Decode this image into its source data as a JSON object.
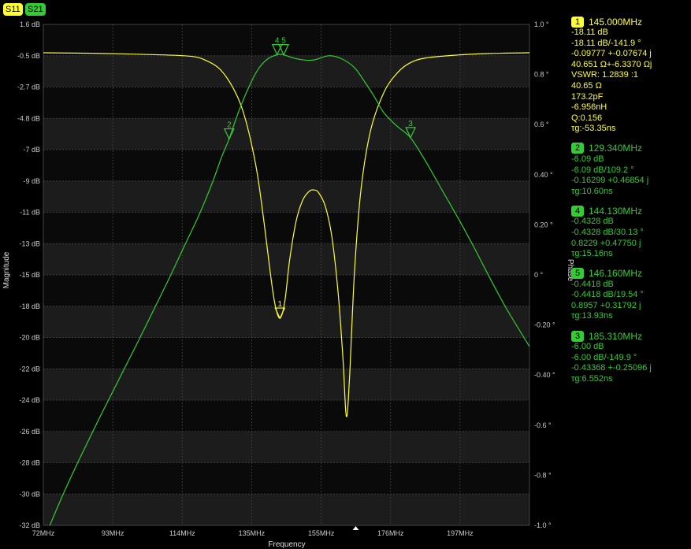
{
  "traces": {
    "s11": {
      "label": "S11",
      "color": "#ffff33"
    },
    "s21": {
      "label": "S21",
      "color": "#33cc33"
    }
  },
  "markers": [
    {
      "id": "1",
      "color": "#ffff33",
      "freq": "145.000MHz",
      "lines": [
        "-18.11 dB",
        "-18.11 dB/-141.9 °",
        "-0.09777 +-0.07674 j",
        "40.651 Ω+-6.3370 Ωj",
        "VSWR: 1.2839 :1",
        "40.65 Ω",
        "173.2pF",
        "-6.956nH",
        "Q:0.156",
        "τg:-53.35ns"
      ]
    },
    {
      "id": "2",
      "color": "#33cc33",
      "freq": "129.340MHz",
      "lines": [
        "-6.09 dB",
        "-6.09 dB/109.2 °",
        "-0.16299 +0.46854 j",
        "τg:10.60ns"
      ]
    },
    {
      "id": "4",
      "color": "#33cc33",
      "freq": "144.130MHz",
      "lines": [
        "-0.4328 dB",
        "-0.4328 dB/30.13 °",
        "0.8229 +0.47750 j",
        "τg:15.16ns"
      ]
    },
    {
      "id": "5",
      "color": "#33cc33",
      "freq": "146.160MHz",
      "lines": [
        "-0.4418 dB",
        "-0.4418 dB/19.54 °",
        "0.8957 +0.31792 j",
        "τg:13.93ns"
      ]
    },
    {
      "id": "3",
      "color": "#33cc33",
      "freq": "185.310MHz",
      "lines": [
        "-6.00 dB",
        "-6.00 dB/-149.9 °",
        "-0.43368 +-0.25096 j",
        "τg:6.552ns"
      ]
    }
  ],
  "chart_data": {
    "type": "line",
    "xlabel": "Frequency",
    "ylabel": "Magnitude",
    "y2label": "Phase",
    "xlim": [
      72,
      222
    ],
    "ylim": [
      -32,
      1.6
    ],
    "y2lim": [
      -1.0,
      1.0
    ],
    "grid": true,
    "x_ticks": [
      "72MHz",
      "93MHz",
      "114MHz",
      "135MHz",
      "155MHz",
      "176MHz",
      "197MHz"
    ],
    "y_ticks": [
      "1.6 dB",
      "-0.5 dB",
      "-2.7 dB",
      "-4.8 dB",
      "-7 dB",
      "-9 dB",
      "-11 dB",
      "-13 dB",
      "-15 dB",
      "-18 dB",
      "-20 dB",
      "-22 dB",
      "-24 dB",
      "-26 dB",
      "-28 dB",
      "-30 dB",
      "-32 dB"
    ],
    "y2_ticks": [
      "1.0 °",
      "0.8 °",
      "0.6 °",
      "0.40 °",
      "0.20 °",
      "0 °",
      "-0.20 °",
      "-0.40 °",
      "-0.6 °",
      "-0.8 °",
      "-1.0 °"
    ],
    "series": [
      {
        "name": "S11",
        "color": "#ffff33",
        "x": [
          72,
          90,
          110,
          118,
          122,
          126,
          129,
          132,
          134,
          136,
          138,
          140,
          142,
          143.5,
          145,
          146.5,
          148,
          150,
          152,
          154,
          155.5,
          157,
          159,
          161,
          163,
          164.5,
          165.5,
          166.5,
          168,
          170,
          173,
          177,
          181,
          185,
          190,
          200,
          210,
          222
        ],
        "y": [
          -0.3,
          -0.35,
          -0.45,
          -0.55,
          -0.8,
          -1.3,
          -2.1,
          -3.3,
          -4.5,
          -6.2,
          -8.4,
          -11.5,
          -15.0,
          -17.2,
          -18.1,
          -17.0,
          -14.2,
          -11.6,
          -10.2,
          -9.6,
          -9.5,
          -9.7,
          -10.6,
          -12.6,
          -16.5,
          -21.0,
          -24.7,
          -22.0,
          -15.0,
          -9.5,
          -5.5,
          -3.0,
          -1.7,
          -1.0,
          -0.65,
          -0.45,
          -0.35,
          -0.3
        ]
      },
      {
        "name": "S21",
        "color": "#33cc33",
        "x": [
          74,
          80,
          90,
          100,
          110,
          115,
          120,
          124,
          127,
          129.3,
          132,
          135,
          138,
          141,
          144.1,
          146.2,
          150,
          155,
          160,
          164,
          168,
          171,
          174,
          177,
          181,
          185.3,
          190,
          195,
          200,
          205,
          210,
          215,
          222
        ],
        "y": [
          -32.0,
          -29.0,
          -24.5,
          -20.2,
          -15.8,
          -13.5,
          -11.2,
          -9.1,
          -7.3,
          -6.09,
          -4.4,
          -2.8,
          -1.5,
          -0.75,
          -0.4328,
          -0.4418,
          -0.7,
          -0.8,
          -0.5,
          -0.7,
          -1.3,
          -2.2,
          -3.2,
          -4.3,
          -5.2,
          -6.0,
          -7.6,
          -9.5,
          -11.4,
          -13.4,
          -15.5,
          -17.5,
          -20.0
        ]
      }
    ],
    "marker_points": [
      {
        "id": "1",
        "series": "S11",
        "x": 145.0,
        "y": -18.11
      },
      {
        "id": "2",
        "series": "S21",
        "x": 129.34,
        "y": -6.09
      },
      {
        "id": "4",
        "series": "S21",
        "x": 144.13,
        "y": -0.4328
      },
      {
        "id": "5",
        "series": "S21",
        "x": 146.16,
        "y": -0.4418
      },
      {
        "id": "3",
        "series": "S21",
        "x": 185.31,
        "y": -6.0
      }
    ]
  }
}
